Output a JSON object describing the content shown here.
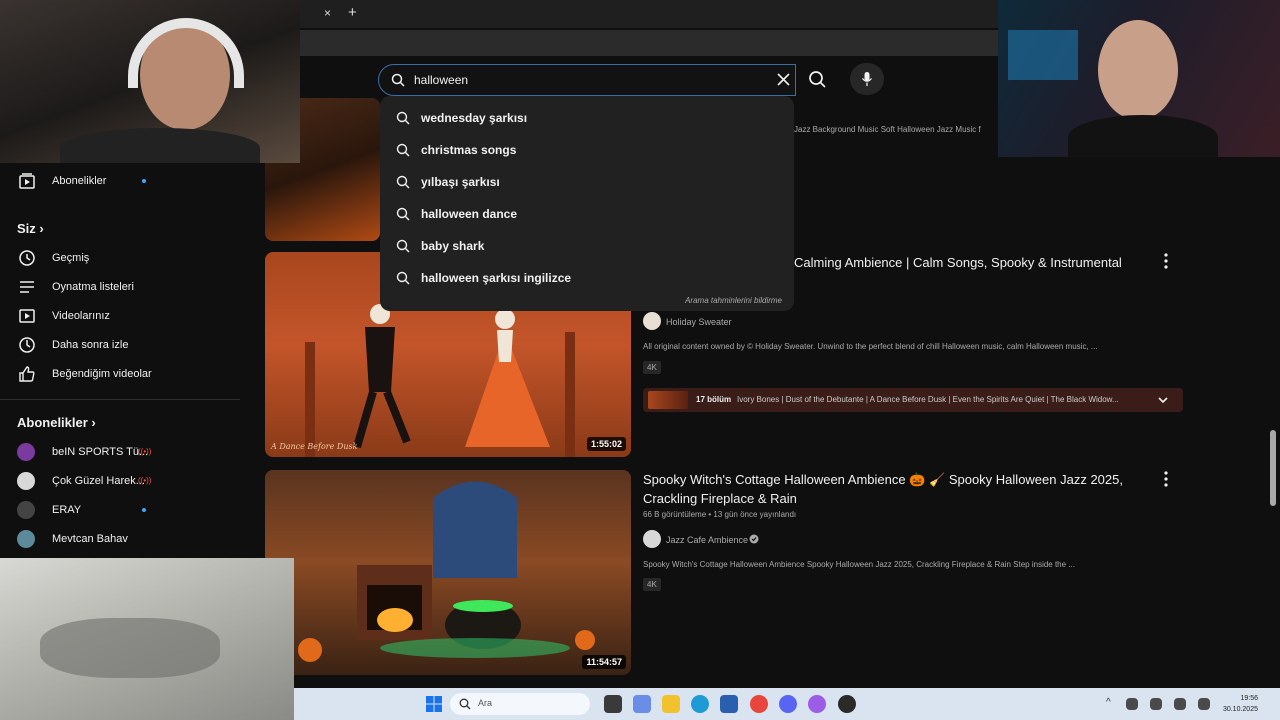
{
  "browser": {
    "tab_close_glyph": "×",
    "new_tab_glyph": "+"
  },
  "search": {
    "query": "halloween",
    "suggestions": [
      "wednesday şarkısı",
      "christmas songs",
      "yılbaşı şarkısı",
      "halloween dance",
      "baby shark",
      "halloween şarkısı ingilizce"
    ],
    "report_label": "Arama tahminlerini bildirme"
  },
  "sidebar": {
    "subscriptions_item": "Abonelikler",
    "you_header": "Siz",
    "you_items": [
      "Geçmiş",
      "Oynatma listeleri",
      "Videolarınız",
      "Daha sonra izle",
      "Beğendiğim videolar"
    ],
    "subs_header": "Abonelikler",
    "channels": [
      "beIN SPORTS Tü...",
      "Çok Güzel Harek...",
      "ERAY",
      "Mevtcan Bahav"
    ]
  },
  "results": {
    "top_partial_text": "Jazz Background Music Soft Halloween Jazz Music f",
    "video1": {
      "title": "Calming Ambience | Calm Songs, Spooky & Instrumental",
      "channel": "Holiday Sweater",
      "description": "All original content owned by © Holiday Sweater. Unwind to the perfect blend of chill Halloween music, calm Halloween music, ...",
      "badge": "4K",
      "duration": "1:55:02",
      "thumb_caption": "A Dance Before Dusk",
      "chapters_count": "17 bölüm",
      "chapters_text": "Ivory Bones | Dust of the Debutante | A Dance Before Dusk | Even the Spirits Are Quiet | The Black Widow..."
    },
    "video2": {
      "title_line1": "Spooky Witch's Cottage Halloween Ambience 🎃 🧹 Spooky Halloween Jazz 2025,",
      "title_line2": "Crackling Fireplace & Rain",
      "views": "66 B görüntüleme",
      "age": "13 gün önce yayınlandı",
      "channel": "Jazz Cafe Ambience",
      "description": "Spooky Witch's Cottage Halloween Ambience Spooky Halloween Jazz 2025, Crackling Fireplace & Rain Step inside the ...",
      "badge": "4K",
      "duration": "11:54:57"
    }
  },
  "taskbar": {
    "search_label": "Ara",
    "time": "19:56",
    "date": "30.10.2025"
  },
  "colors": {
    "accent_blue": "#3ea6ff",
    "live_red": "#ff4e45",
    "chapter_bg": "#3a1d18"
  }
}
